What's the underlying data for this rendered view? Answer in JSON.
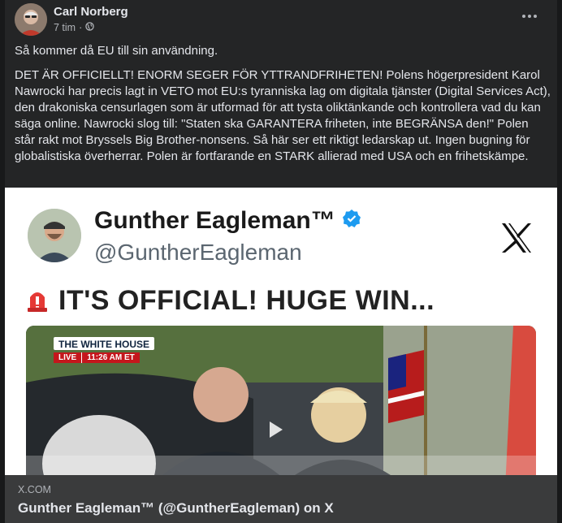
{
  "post": {
    "author": "Carl Norberg",
    "time": "7 tim",
    "separator": "·",
    "audience_icon": "globe-icon",
    "more_icon": "more-options-icon",
    "text_intro": "Så kommer då EU till sin användning.",
    "text_body": "DET ÄR OFFICIELLT! ENORM SEGER FÖR YTTRANDFRIHETEN! Polens högerpresident Karol Nawrocki har precis lagt in VETO mot EU:s tyranniska lag om digitala tjänster (Digital Services Act), den drakoniska censurlagen som är utformad för att tysta oliktänkande och kontrollera vad du kan säga online. Nawrocki slog till: \"Staten ska GARANTERA friheten, inte BEGRÄNSA den!\" Polen står rakt mot Bryssels Big Brother-nonsens. Så här ser ett riktigt ledarskap ut. Ingen bugning för globalistiska överherrar. Polen är fortfarande en STARK allierad med USA och en frihetskämpe."
  },
  "media": {
    "tweet_name": "Gunther Eagleman™",
    "tweet_handle": "@GuntherEagleman",
    "verified_icon": "verified-badge-icon",
    "x_logo": "x-logo-icon",
    "headline": "IT'S OFFICIAL! HUGE WIN...",
    "siren_icon": "siren-icon",
    "video_banner": "THE WHITE HOUSE",
    "video_live": "LIVE",
    "video_time": "11:26 AM ET",
    "play_icon": "play-icon"
  },
  "link": {
    "domain": "X.COM",
    "title": "Gunther Eagleman™ (@GuntherEagleman) on X"
  }
}
